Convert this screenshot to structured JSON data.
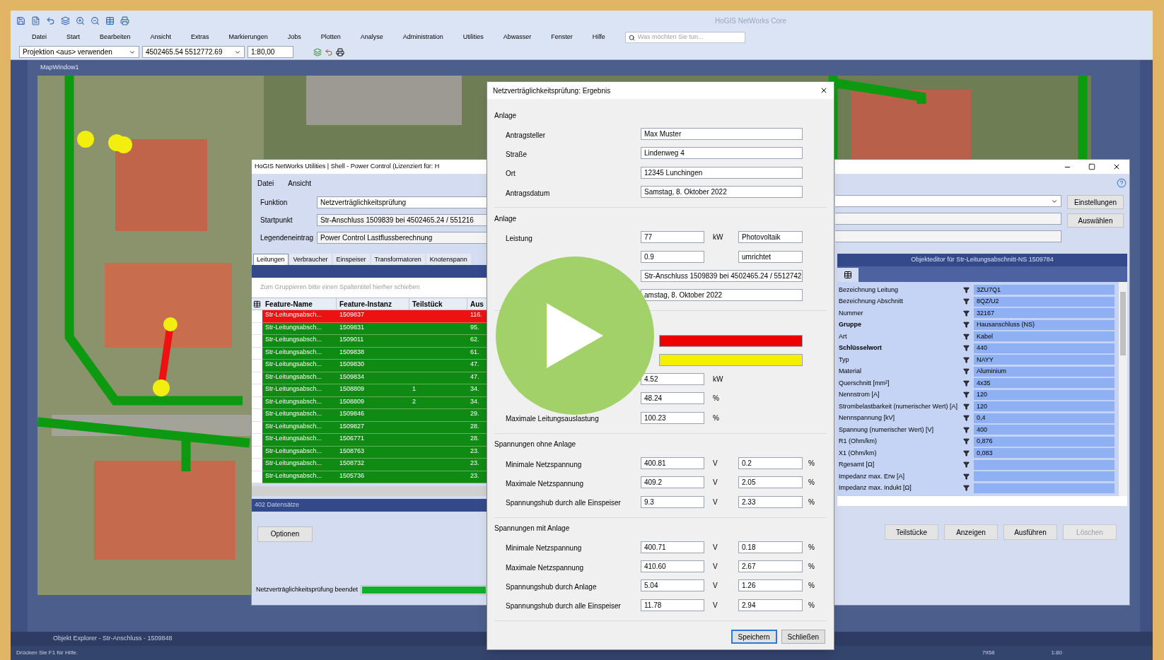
{
  "app": {
    "title": "HoGIS NetWorks Core",
    "menu": [
      "Datei",
      "Start",
      "Bearbeiten",
      "Ansicht",
      "Extras",
      "Markierungen",
      "Jobs",
      "Plotten",
      "Analyse",
      "Administration",
      "Utilities",
      "Abwasser",
      "Fenster",
      "Hilfe"
    ],
    "search": {
      "placeholder": "Was möchten Sie tun..."
    },
    "toolbar": {
      "projection": "Projektion <aus> verwenden",
      "coordinates": "4502465.54 5512772.69",
      "scale": "1:80,00"
    },
    "map_tab": "MapWindow1"
  },
  "power_control": {
    "title": "HoGIS NetWorks Utilities | Shell - Power Control (Lizenziert für: H",
    "menu": [
      "Datei",
      "Ansicht"
    ],
    "fields": [
      {
        "label": "Funktion",
        "value": "Netzverträglichkeitsprüfung",
        "kind": "combo"
      },
      {
        "label": "Startpunkt",
        "value": "Str-Anschluss 1509839 bei 4502465.24 / 551216",
        "kind": "text"
      },
      {
        "label": "Legendeneintrag",
        "value": "Power Control Lastflussberechnung",
        "kind": "text"
      }
    ],
    "side_buttons": [
      "Einstellungen",
      "Auswählen"
    ],
    "tabs": [
      {
        "label": "Leitungen",
        "selected": true
      },
      {
        "label": "Verbraucher",
        "selected": false
      },
      {
        "label": "Einspeiser",
        "selected": false
      },
      {
        "label": "Transformatoren",
        "selected": false
      },
      {
        "label": "Knotenspann",
        "selected": false
      }
    ],
    "group_hint": "Zum Gruppieren bitte einen Spaltentitel hierher schieben",
    "columns": [
      "Feature-Name",
      "Feature-Instanz",
      "Teilstück",
      "Aus"
    ],
    "rows": [
      {
        "name": "Str-Leitungsabsch...",
        "instance": "1509837",
        "value": "116.",
        "color": "#ee1111"
      },
      {
        "name": "Str-Leitungsabsch...",
        "instance": "1509831",
        "value": "95.",
        "color": "#0f8a12"
      },
      {
        "name": "Str-Leitungsabsch...",
        "instance": "1509011",
        "value": "62.",
        "color": "#0f8a12"
      },
      {
        "name": "Str-Leitungsabsch...",
        "instance": "1509838",
        "value": "61.",
        "color": "#0f8a12"
      },
      {
        "name": "Str-Leitungsabsch...",
        "instance": "1509830",
        "value": "47.",
        "color": "#0f8a12"
      },
      {
        "name": "Str-Leitungsabsch...",
        "instance": "1509834",
        "value": "47.",
        "color": "#0f8a12"
      },
      {
        "name": "Str-Leitungsabsch...",
        "instance": "1508809",
        "part": "1",
        "value": "34.",
        "color": "#0f8a12"
      },
      {
        "name": "Str-Leitungsabsch...",
        "instance": "1508809",
        "part": "2",
        "value": "34.",
        "color": "#0f8a12"
      },
      {
        "name": "Str-Leitungsabsch...",
        "instance": "1509846",
        "value": "29.",
        "color": "#0f8a12"
      },
      {
        "name": "Str-Leitungsabsch...",
        "instance": "1509827",
        "value": "28.",
        "color": "#0f8a12"
      },
      {
        "name": "Str-Leitungsabsch...",
        "instance": "1506771",
        "value": "28.",
        "color": "#0f8a12"
      },
      {
        "name": "Str-Leitungsabsch...",
        "instance": "1508763",
        "value": "23.",
        "color": "#0f8a12"
      },
      {
        "name": "Str-Leitungsabsch...",
        "instance": "1508732",
        "value": "23.",
        "color": "#0f8a12"
      },
      {
        "name": "Str-Leitungsabsch...",
        "instance": "1505736",
        "value": "23.",
        "color": "#0f8a12"
      }
    ],
    "record_count": "402 Datensätze",
    "options_button": "Optionen",
    "progress": {
      "label": "Netzverträglichkeitsprüfung beendet",
      "level": 1
    },
    "editor": {
      "title": "Objekteditor für Str-Leitungsabschnitt-NS 1509784",
      "rows": [
        {
          "label": "Bezeichnung Leitung",
          "value": "3ZU7Q1",
          "bold": false
        },
        {
          "label": "Bezeichnung Abschnitt",
          "value": "8QZ/U2",
          "bold": false
        },
        {
          "label": "Nummer",
          "value": "32167",
          "bold": false
        },
        {
          "label": "Gruppe",
          "value": "Hausanschluss (NS)",
          "bold": true
        },
        {
          "label": "Art",
          "value": "Kabel",
          "bold": false
        },
        {
          "label": "Schlüsselwort",
          "value": "440",
          "bold": true
        },
        {
          "label": "Typ",
          "value": "NAYY",
          "bold": false
        },
        {
          "label": "Material",
          "value": "Aluminium",
          "bold": false
        },
        {
          "label": "Querschnitt [mm²]",
          "value": "4x35",
          "bold": false
        },
        {
          "label": "Nennstrom [A]",
          "value": "120",
          "bold": false
        },
        {
          "label": "Strombelastbarkeit (numerischer Wert) [A]",
          "value": "120",
          "bold": false
        },
        {
          "label": "Nennspannung [kV]",
          "value": "0,4",
          "bold": false
        },
        {
          "label": "Spannung (numerischer Wert) [V]",
          "value": "400",
          "bold": false
        },
        {
          "label": "R1 (Ohm/km)",
          "value": "0,876",
          "bold": false
        },
        {
          "label": "X1 (Ohm/km)",
          "value": "0,083",
          "bold": false
        },
        {
          "label": "Rgesamt [Ω]",
          "bold": false
        },
        {
          "label": "Impedanz max. Erw [A]",
          "bold": false
        },
        {
          "label": "Impedanz max. Indukt [Ω]",
          "bold": false
        }
      ]
    },
    "buttons": [
      {
        "label": "Teilstücke",
        "disabled": false
      },
      {
        "label": "Anzeigen",
        "disabled": false
      },
      {
        "label": "Ausführen",
        "disabled": false
      },
      {
        "label": "Löschen",
        "disabled": true
      }
    ]
  },
  "dialog": {
    "title": "Netzverträglichkeitsprüfung: Ergebnis",
    "sections": [
      {
        "title": "Anlage",
        "rows": [
          {
            "kind": "text",
            "label": "Antragsteller",
            "value": "Max Muster"
          },
          {
            "kind": "text",
            "label": "Straße",
            "value": "Lindenweg 4"
          },
          {
            "kind": "text",
            "label": "Ort",
            "value": "12345 Lunchingen"
          },
          {
            "kind": "text",
            "label": "Antragsdatum",
            "value": "Samstag, 8. Oktober 2022"
          }
        ]
      },
      {
        "title": "Anlage",
        "rows": [
          {
            "kind": "pair",
            "label": "Leistung",
            "value": "77",
            "unit": "kW",
            "value2": "Photovoltaik"
          },
          {
            "kind": "pair",
            "value": "0.9",
            "value2": "umrichtet"
          },
          {
            "kind": "text",
            "value": "Str-Anschluss 1509839 bei 4502465.24 / 5512742"
          },
          {
            "kind": "text",
            "value": "amstag, 8. Oktober 2022"
          }
        ]
      },
      {
        "rows": [
          {
            "kind": "status",
            "color": "#ee0000"
          },
          {
            "kind": "status",
            "color": "#f5f000"
          },
          {
            "kind": "pair",
            "value": "4.52",
            "unit": "kW"
          },
          {
            "kind": "pair",
            "value": "48.24",
            "unit": "%"
          },
          {
            "kind": "pair",
            "label": "Maximale Leitungsauslastung",
            "value": "100.23",
            "unit": "%"
          }
        ]
      },
      {
        "title": "Spannungen ohne Anlage",
        "rows": [
          {
            "kind": "pair",
            "label": "Minimale Netzspannung",
            "value": "400.81",
            "unit": "V",
            "value2": "0.2",
            "unit2": "%"
          },
          {
            "kind": "pair",
            "label": "Maximale Netzspannung",
            "value": "409.2",
            "unit": "V",
            "value2": "2.05",
            "unit2": "%"
          },
          {
            "kind": "pair",
            "label": "Spannungshub durch alle Einspeiser",
            "value": "9.3",
            "unit": "V",
            "value2": "2.33",
            "unit2": "%"
          }
        ]
      },
      {
        "title": "Spannungen mit Anlage",
        "rows": [
          {
            "kind": "pair",
            "label": "Minimale Netzspannung",
            "value": "400.71",
            "unit": "V",
            "value2": "0.18",
            "unit2": "%"
          },
          {
            "kind": "pair",
            "label": "Maximale Netzspannung",
            "value": "410.60",
            "unit": "V",
            "value2": "2.67",
            "unit2": "%"
          },
          {
            "kind": "pair",
            "label": "Spannungshub durch Anlage",
            "value": "5.04",
            "unit": "V",
            "value2": "1.26",
            "unit2": "%"
          },
          {
            "kind": "pair",
            "label": "Spannungshub durch alle Einspeiser",
            "value": "11.78",
            "unit": "V",
            "value2": "2.94",
            "unit2": "%"
          }
        ]
      }
    ],
    "buttons": [
      {
        "label": "Speichern",
        "selected": true
      },
      {
        "label": "Schließen",
        "selected": false
      }
    ]
  },
  "object_explorer": "Objekt Explorer - Str-Anschluss - 1509848",
  "status_bar": {
    "hint": "Drücken Sie F1 für Hilfe.",
    "values": [
      "7958",
      "1:80"
    ]
  }
}
